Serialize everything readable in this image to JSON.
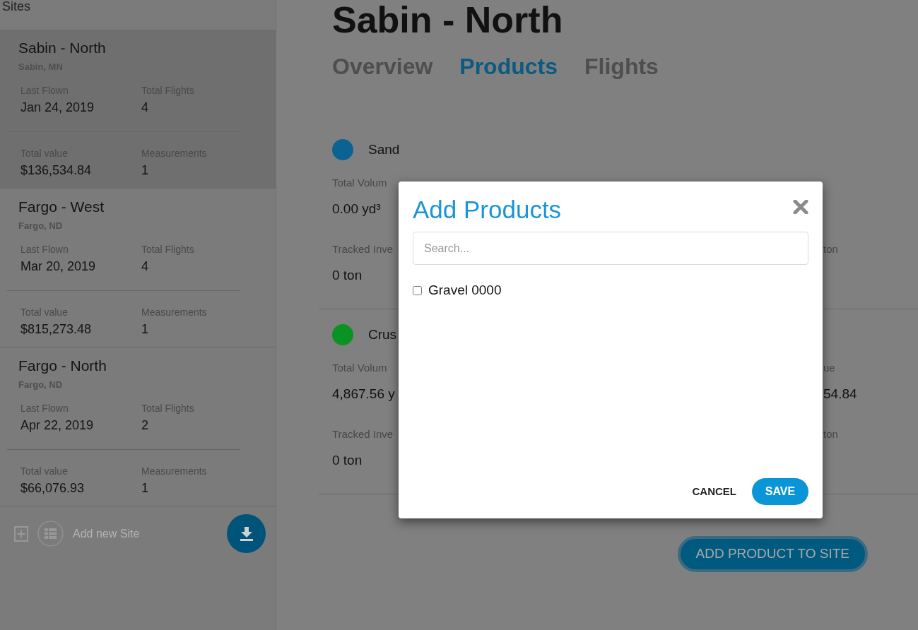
{
  "sidebar": {
    "title": "Sites",
    "sites": [
      {
        "name": "Sabin - North",
        "location": "Sabin, MN",
        "selected": true,
        "stat_groups": [
          {
            "stats": [
              {
                "label": "Last Flown",
                "value": "Jan 24, 2019"
              },
              {
                "label": "Total Flights",
                "value": "4"
              }
            ]
          },
          {
            "stats": [
              {
                "label": "Total value",
                "value": "$136,534.84"
              },
              {
                "label": "Measurements",
                "value": "1"
              }
            ]
          }
        ]
      },
      {
        "name": "Fargo - West",
        "location": "Fargo, ND",
        "selected": false,
        "stat_groups": [
          {
            "stats": [
              {
                "label": "Last Flown",
                "value": "Mar 20, 2019"
              },
              {
                "label": "Total Flights",
                "value": "4"
              }
            ]
          },
          {
            "stats": [
              {
                "label": "Total value",
                "value": "$815,273.48"
              },
              {
                "label": "Measurements",
                "value": "1"
              }
            ]
          }
        ]
      },
      {
        "name": "Fargo - North",
        "location": "Fargo, ND",
        "selected": false,
        "stat_groups": [
          {
            "stats": [
              {
                "label": "Last Flown",
                "value": "Apr 22, 2019"
              },
              {
                "label": "Total Flights",
                "value": "2"
              }
            ]
          },
          {
            "stats": [
              {
                "label": "Total value",
                "value": "$66,076.93"
              },
              {
                "label": "Measurements",
                "value": "1"
              }
            ]
          }
        ]
      }
    ],
    "add_site": {
      "label": "Add new Site"
    }
  },
  "main": {
    "title": "Sabin - North",
    "tabs": [
      {
        "label": "Overview",
        "selected": false
      },
      {
        "label": "Products",
        "selected": true
      },
      {
        "label": "Flights",
        "selected": false
      }
    ],
    "products": [
      {
        "name": "Sand",
        "color": "#0b6391",
        "rows": [
          {
            "left": {
              "label": "Total Volum",
              "value": "0.00 yd³"
            }
          },
          {
            "left": {
              "label": "Tracked Inve",
              "value": "0 ton"
            },
            "right": {
              "label": "ton"
            }
          }
        ]
      },
      {
        "name": "Crus",
        "color": "#0a9323",
        "rows": [
          {
            "left": {
              "label": "Total Volum",
              "value": "4,867.56 y"
            },
            "right": {
              "label": "ue",
              "value": "54.84"
            }
          },
          {
            "left": {
              "label": "Tracked Inve",
              "value": "0 ton"
            },
            "right": {
              "label": "ton"
            }
          }
        ]
      }
    ],
    "add_product_button": "ADD PRODUCT TO SITE"
  },
  "modal": {
    "title": "Add Products",
    "search": {
      "placeholder": "Search..."
    },
    "options": [
      {
        "label": "Gravel 0000",
        "checked": false
      }
    ],
    "buttons": [
      {
        "label": "CANCEL",
        "kind": "text"
      },
      {
        "label": "SAVE",
        "kind": "primary"
      }
    ]
  }
}
